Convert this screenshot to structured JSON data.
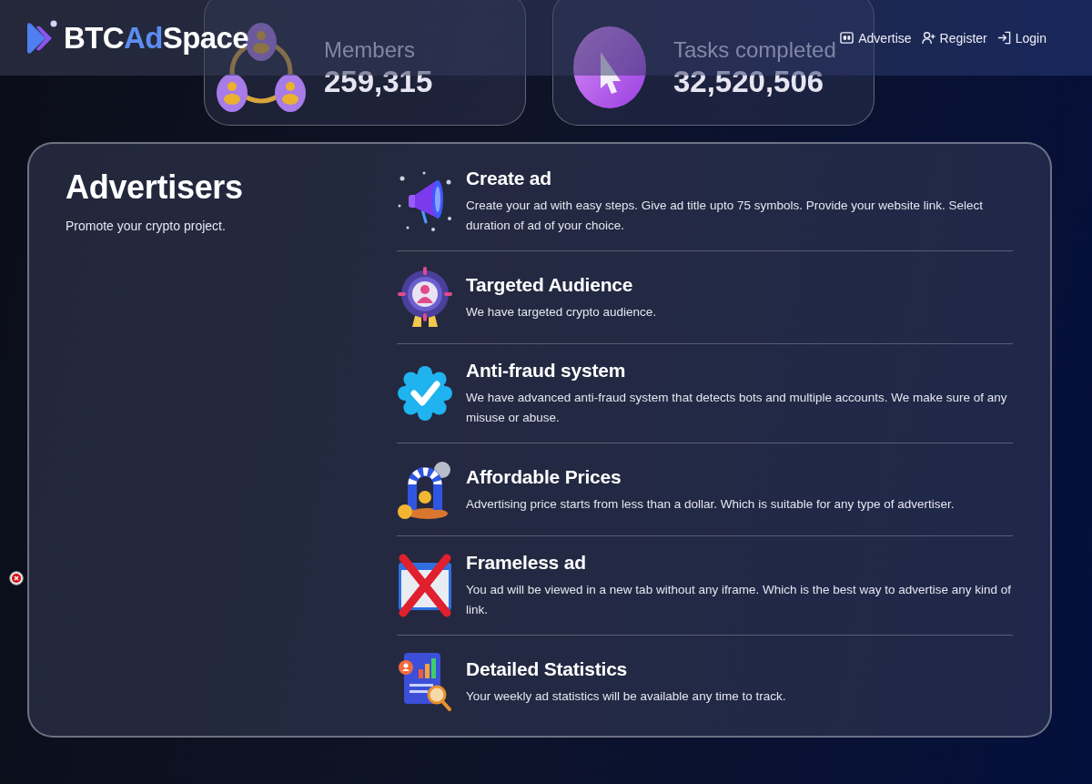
{
  "navbar": {
    "logo": {
      "parts": [
        {
          "text": "BTC",
          "highlighted": false
        },
        {
          "text": "Ad",
          "highlighted": true
        },
        {
          "text": "Space",
          "highlighted": false
        }
      ]
    },
    "links": [
      {
        "label": "Advertise"
      },
      {
        "label": "Register"
      },
      {
        "label": "Login"
      }
    ]
  },
  "stats": [
    {
      "label": "Members",
      "value": "259,315"
    },
    {
      "label": "Tasks completed",
      "value": "32,520,506"
    }
  ],
  "advertisers": {
    "title": "Advertisers",
    "subtitle": "Promote your crypto project.",
    "features": [
      {
        "title": "Create ad",
        "description": "Create your ad with easy steps. Give ad title upto 75 symbols. Provide your website link. Select duration of ad of your choice."
      },
      {
        "title": "Targeted Audience",
        "description": "We have targeted crypto audience."
      },
      {
        "title": "Anti-fraud system",
        "description": "We have advanced anti-fraud system that detects bots and multiple accounts. We make sure of any misuse or abuse."
      },
      {
        "title": "Affordable Prices",
        "description": "Advertising price starts from less than a dollar. Which is suitable for any type of advertiser."
      },
      {
        "title": "Frameless ad",
        "description": "You ad will be viewed in a new tab without any iframe. Which is the best way to advertise any kind of link."
      },
      {
        "title": "Detailed Statistics",
        "description": "Your weekly ad statistics will be available any time to track."
      }
    ]
  }
}
